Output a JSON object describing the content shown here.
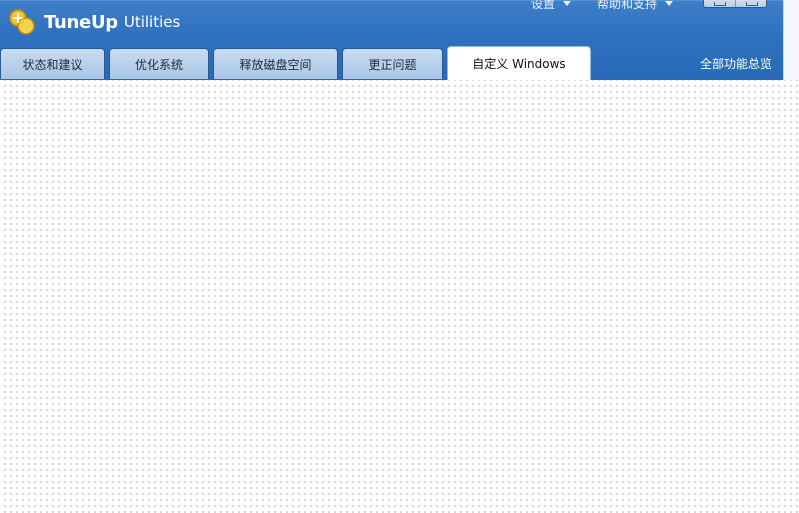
{
  "app": {
    "brand": "TuneUp",
    "product": "Utilities"
  },
  "top_menu": {
    "settings_label": "设置",
    "help_label": "帮助和支持"
  },
  "tabs": [
    {
      "label": "状态和建议",
      "active": false
    },
    {
      "label": "优化系统",
      "active": false
    },
    {
      "label": "释放磁盘空间",
      "active": false
    },
    {
      "label": "更正问题",
      "active": false
    },
    {
      "label": "自定义 Windows",
      "active": true
    }
  ],
  "all_features_label": "全部功能总览",
  "colors": {
    "header_blue": "#2f71be",
    "tab_inactive": "#b3cdea",
    "logo_yellow": "#f4c430"
  },
  "icons": [
    "tuneup-logo-icon",
    "dropdown-caret-icon",
    "minimize-icon",
    "maximize-icon"
  ]
}
